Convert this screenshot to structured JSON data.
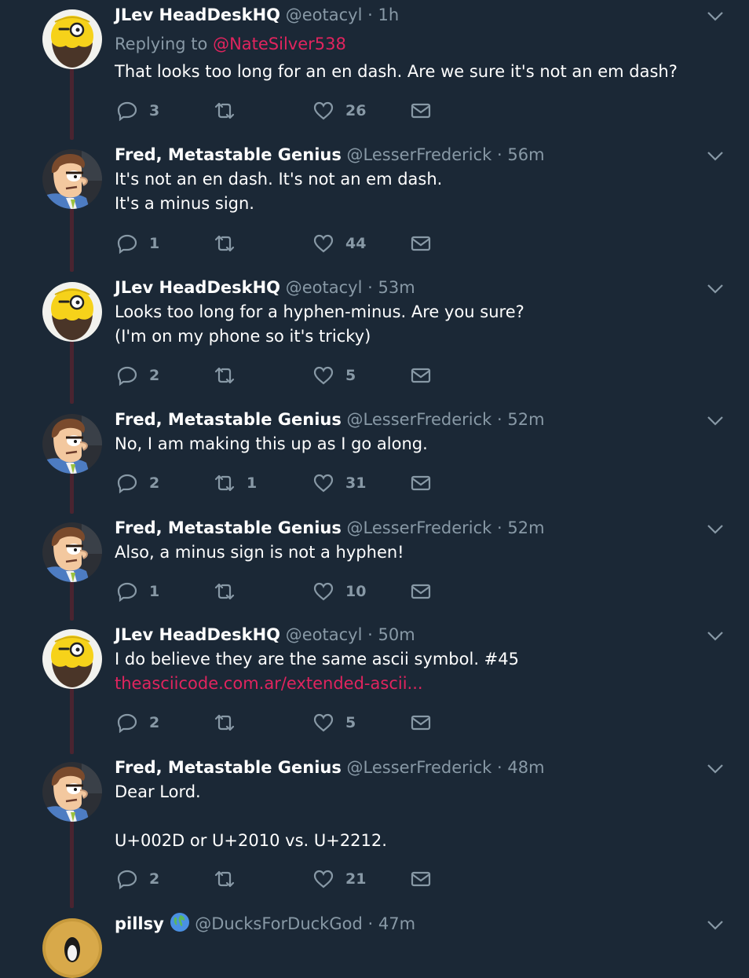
{
  "tweets": [
    {
      "name": "JLev HeadDeskHQ",
      "handle": "@eotacyl",
      "time": "1h",
      "avatar": "jlev",
      "replying_label": "Replying to ",
      "replying_to": "@NateSilver538",
      "lines": [
        "That looks too long for an en dash. Are we sure it's not an em dash?"
      ],
      "replies": "3",
      "retweets": "",
      "likes": "26"
    },
    {
      "name": "Fred, Metastable Genius",
      "handle": "@LesserFrederick",
      "time": "56m",
      "avatar": "fred",
      "lines": [
        "It's not an en dash. It's not an em dash.",
        "It's a minus sign."
      ],
      "replies": "1",
      "retweets": "",
      "likes": "44"
    },
    {
      "name": "JLev HeadDeskHQ",
      "handle": "@eotacyl",
      "time": "53m",
      "avatar": "jlev",
      "lines": [
        "Looks too long for a hyphen-minus. Are you sure?",
        "(I'm on my phone so it's tricky)"
      ],
      "replies": "2",
      "retweets": "",
      "likes": "5"
    },
    {
      "name": "Fred, Metastable Genius",
      "handle": "@LesserFrederick",
      "time": "52m",
      "avatar": "fred",
      "lines": [
        "No, I am making this up as I go along."
      ],
      "replies": "2",
      "retweets": "1",
      "likes": "31"
    },
    {
      "name": "Fred, Metastable Genius",
      "handle": "@LesserFrederick",
      "time": "52m",
      "avatar": "fred",
      "lines": [
        "Also, a minus sign is not a hyphen!"
      ],
      "replies": "1",
      "retweets": "",
      "likes": "10"
    },
    {
      "name": "JLev HeadDeskHQ",
      "handle": "@eotacyl",
      "time": "50m",
      "avatar": "jlev",
      "lines": [
        "I do believe they are the same ascii symbol. #45"
      ],
      "link": "theasciicode.com.ar/extended-ascii...",
      "replies": "2",
      "retweets": "",
      "likes": "5"
    },
    {
      "name": "Fred, Metastable Genius",
      "handle": "@LesserFrederick",
      "time": "48m",
      "avatar": "fred",
      "lines": [
        "Dear Lord.",
        "",
        "U+002D or U+2010 vs. U+2212."
      ],
      "replies": "2",
      "retweets": "",
      "likes": "21"
    },
    {
      "name": "pillsy",
      "handle": "@DucksForDuckGod",
      "time": "47m",
      "avatar": "pillsy",
      "verified_icon": "globe-emoji-icon",
      "lines": [],
      "replies": "",
      "retweets": "",
      "likes": ""
    }
  ],
  "colors": {
    "background": "#1b2836",
    "accent": "#e0245e",
    "muted": "#8899a6",
    "thread_line": "#4a2430"
  }
}
